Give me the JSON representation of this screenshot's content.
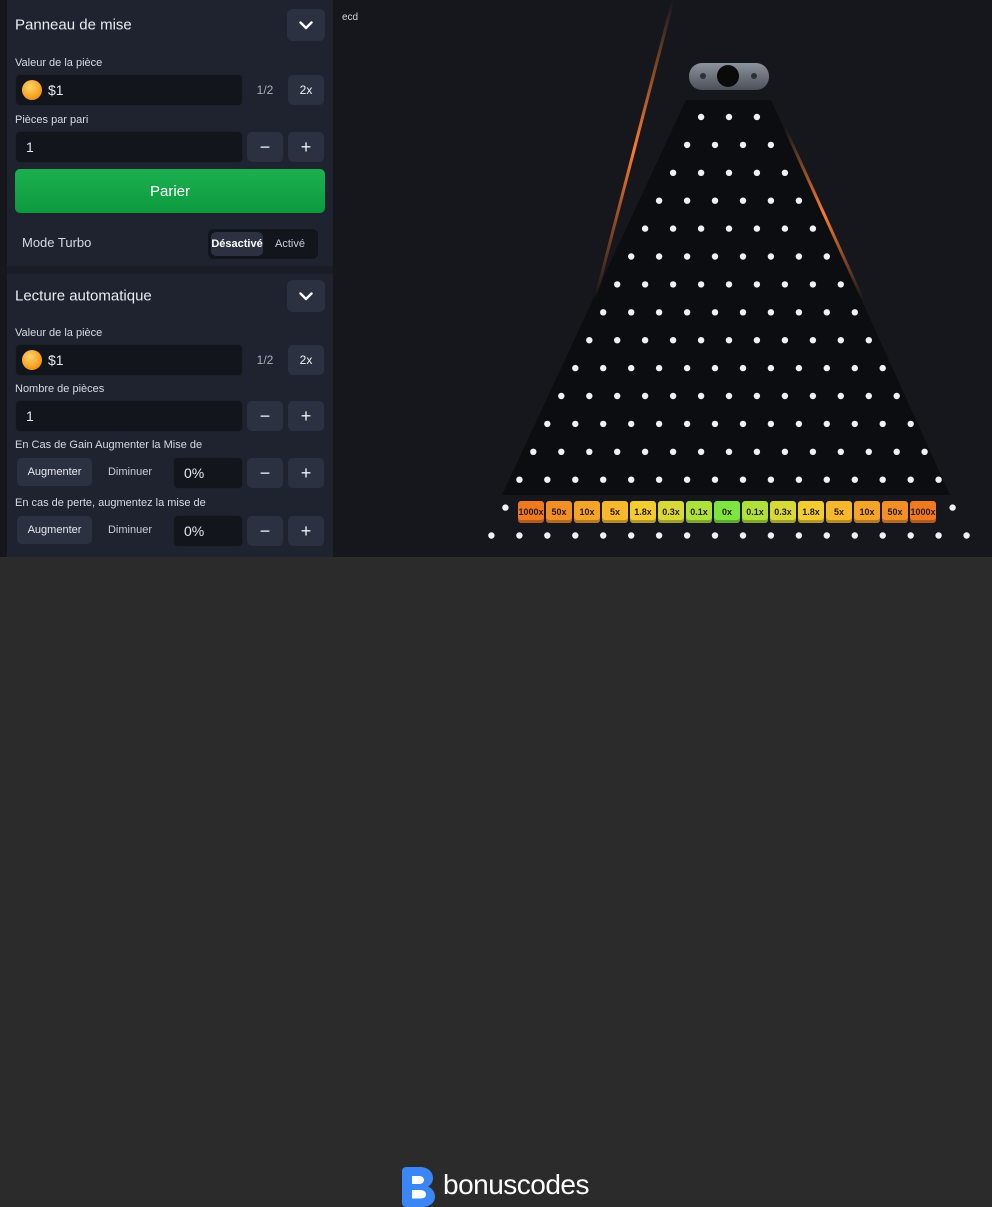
{
  "bet_panel": {
    "title": "Panneau de mise",
    "coin_value_label": "Valeur de la pièce",
    "coin_value": "$1",
    "half_label": "1/2",
    "double_label": "2x",
    "coins_per_bet_label": "Pièces par pari",
    "coins_per_bet": "1",
    "minus": "−",
    "plus": "+",
    "bet_button": "Parier",
    "turbo_label": "Mode Turbo",
    "turbo_off": "Désactivé",
    "turbo_on": "Activé"
  },
  "autoplay": {
    "title": "Lecture automatique",
    "coin_value_label": "Valeur de la pièce",
    "coin_value": "$1",
    "half_label": "1/2",
    "double_label": "2x",
    "coin_count_label": "Nombre de pièces",
    "coin_count": "1",
    "on_win_label": "En Cas de Gain Augmenter la Mise de",
    "on_win_increase": "Augmenter",
    "on_win_decrease": "Diminuer",
    "on_win_value": "0%",
    "on_loss_label": "En cas de perte, augmentez la mise de",
    "on_loss_increase": "Augmenter",
    "on_loss_decrease": "Diminuer",
    "on_loss_value": "0%"
  },
  "board": {
    "label": "ecd",
    "multipliers": [
      "1000x",
      "50x",
      "10x",
      "5x",
      "1.8x",
      "0.3x",
      "0.1x",
      "0x",
      "0.1x",
      "0.3x",
      "1.8x",
      "5x",
      "10x",
      "50x",
      "1000x"
    ],
    "multiplier_colors": [
      "#f07a22",
      "#f28f26",
      "#f5a42a",
      "#f7b82d",
      "#f2cd31",
      "#d6d936",
      "#aee13a",
      "#7ee43f",
      "#aee13a",
      "#d6d936",
      "#f2cd31",
      "#f7b82d",
      "#f5a42a",
      "#f28f26",
      "#f07a22"
    ],
    "peg_rows": 16
  },
  "footer": {
    "brand": "bonuscodes",
    "brand_color": "#3a86f5"
  }
}
